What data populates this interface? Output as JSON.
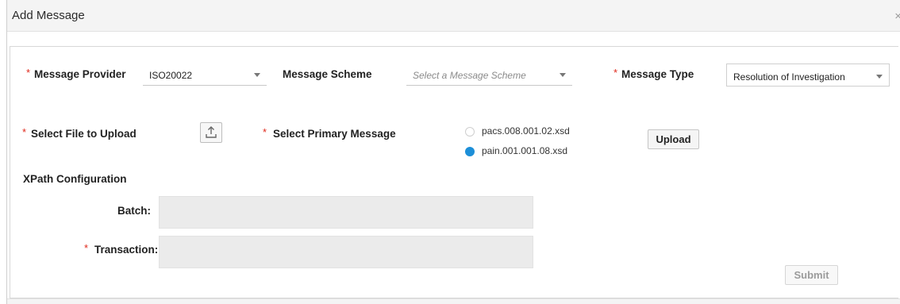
{
  "dialog": {
    "title": "Add Message",
    "close_glyph": "×"
  },
  "required_mark": "*",
  "row1": {
    "provider_label": "Message Provider",
    "provider_value": "ISO20022",
    "scheme_label": "Message Scheme",
    "scheme_placeholder": "Select a Message Scheme",
    "type_label": "Message Type",
    "type_value": "Resolution of Investigation"
  },
  "row2": {
    "file_label": "Select File to Upload",
    "upload_icon": "upload-icon",
    "primary_label": "Select Primary Message",
    "options": [
      {
        "label": "pacs.008.001.02.xsd",
        "checked": false
      },
      {
        "label": "pain.001.001.08.xsd",
        "checked": true
      }
    ],
    "upload_button": "Upload"
  },
  "xpath": {
    "section_title": "XPath Configuration",
    "batch_label": "Batch:",
    "batch_value": "",
    "transaction_label": "Transaction:",
    "transaction_value": ""
  },
  "footer": {
    "submit_label": "Submit",
    "submit_disabled": true
  }
}
